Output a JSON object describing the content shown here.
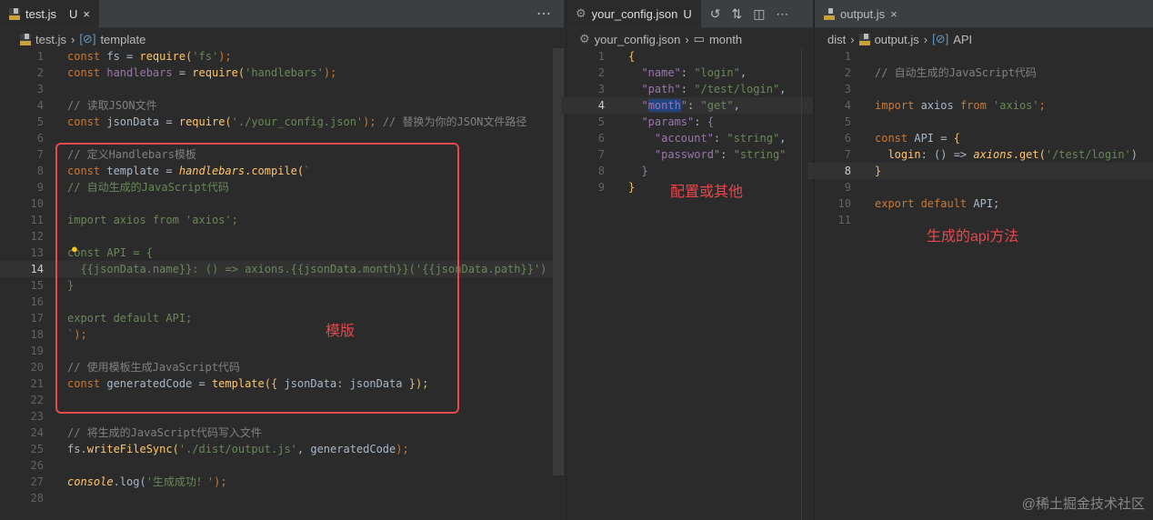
{
  "left": {
    "tab": "test.js",
    "tab_status": "U",
    "crumb_file": "test.js",
    "crumb_symbol": "template",
    "more": "⋯",
    "lines": [
      [
        [
          "const ",
          "kw"
        ],
        [
          "fs = ",
          "pl"
        ],
        [
          "require",
          "fn"
        ],
        [
          "(",
          "br"
        ],
        [
          "'fs'",
          "str"
        ],
        [
          ");",
          "kw"
        ]
      ],
      [
        [
          "const ",
          "kw"
        ],
        [
          "handlebars",
          "var"
        ],
        [
          " = ",
          "pl"
        ],
        [
          "require",
          "fn"
        ],
        [
          "(",
          "br"
        ],
        [
          "'handlebars'",
          "str"
        ],
        [
          ");",
          "kw"
        ]
      ],
      [],
      [
        [
          "// 读取JSON文件",
          "cm"
        ]
      ],
      [
        [
          "const ",
          "kw"
        ],
        [
          "jsonData = ",
          "pl"
        ],
        [
          "require",
          "fn"
        ],
        [
          "(",
          "br"
        ],
        [
          "'./your_config.json'",
          "str"
        ],
        [
          ");",
          "kw"
        ],
        [
          " // 替换为你的JSON文件路径",
          "cm"
        ]
      ],
      [],
      [
        [
          "// 定义Handlebars模板",
          "cm"
        ]
      ],
      [
        [
          "const ",
          "kw"
        ],
        [
          "template = ",
          "pl"
        ],
        [
          "handlebars",
          "it"
        ],
        [
          ".compile(",
          "fn"
        ],
        [
          "`",
          "str"
        ]
      ],
      [
        [
          "// 自动生成的JavaScript代码",
          "str"
        ]
      ],
      [],
      [
        [
          "import axios from 'axios';",
          "str"
        ]
      ],
      [],
      [
        [
          "const API = {",
          "str"
        ]
      ],
      [
        [
          "  {{jsonData.name}}: () => axions.{{jsonData.month}}('{{jsonData.path}}')",
          "str"
        ]
      ],
      [
        [
          "}",
          "str"
        ]
      ],
      [],
      [
        [
          "export default API;",
          "str"
        ]
      ],
      [
        [
          "`",
          "str"
        ],
        [
          ");",
          "kw"
        ]
      ],
      [],
      [
        [
          "// 使用模板生成JavaScript代码",
          "cm"
        ]
      ],
      [
        [
          "const ",
          "kw"
        ],
        [
          "generatedCode = ",
          "pl"
        ],
        [
          "template",
          "fn"
        ],
        [
          "({ ",
          "br"
        ],
        [
          "jsonData: jsonData ",
          "pl"
        ],
        [
          "});",
          "br"
        ]
      ],
      [],
      [],
      [
        [
          "// 将生成的JavaScript代码写入文件",
          "cm"
        ]
      ],
      [
        [
          "fs.",
          "pl"
        ],
        [
          "writeFileSync",
          "fn"
        ],
        [
          "(",
          "br"
        ],
        [
          "'./dist/output.js'",
          "str"
        ],
        [
          ", generatedCode",
          "pl"
        ],
        [
          ");",
          "kw"
        ]
      ],
      [],
      [
        [
          "console",
          "it"
        ],
        [
          ".log(",
          "pl"
        ],
        [
          "'生成成功！'",
          "str"
        ],
        [
          ");",
          "kw"
        ]
      ],
      []
    ],
    "current_line": 14,
    "note": "模版"
  },
  "middle": {
    "tab": "your_config.json",
    "tab_status": "U",
    "crumb_file": "your_config.json",
    "crumb_symbol": "month",
    "lines": [
      [
        [
          "{",
          "br"
        ]
      ],
      [
        [
          "  \"name\"",
          "key"
        ],
        [
          ": ",
          "pl"
        ],
        [
          "\"login\"",
          "str"
        ],
        [
          ",",
          "pl"
        ]
      ],
      [
        [
          "  \"path\"",
          "key"
        ],
        [
          ": ",
          "pl"
        ],
        [
          "\"/test/login\"",
          "str"
        ],
        [
          ",",
          "pl"
        ]
      ],
      [
        [
          "  \"",
          "key"
        ],
        [
          "month",
          "sel"
        ],
        [
          "\"",
          "key"
        ],
        [
          ": ",
          "pl"
        ],
        [
          "\"get\"",
          "str"
        ],
        [
          ",",
          "pl"
        ]
      ],
      [
        [
          "  \"params\"",
          "key"
        ],
        [
          ": ",
          "pl"
        ],
        [
          "{",
          "var"
        ]
      ],
      [
        [
          "    \"account\"",
          "key"
        ],
        [
          ": ",
          "pl"
        ],
        [
          "\"string\"",
          "str"
        ],
        [
          ",",
          "pl"
        ]
      ],
      [
        [
          "    \"password\"",
          "key"
        ],
        [
          ": ",
          "pl"
        ],
        [
          "\"string\"",
          "str"
        ]
      ],
      [
        [
          "  }",
          "var"
        ]
      ],
      [
        [
          "}",
          "br"
        ]
      ]
    ],
    "current_line": 4,
    "note": "配置或其他"
  },
  "right": {
    "tab": "output.js",
    "crumb_dir": "dist",
    "crumb_file": "output.js",
    "crumb_symbol": "API",
    "lines": [
      [],
      [
        [
          "// 自动生成的JavaScript代码",
          "cm"
        ]
      ],
      [],
      [
        [
          "import ",
          "kw"
        ],
        [
          "axios ",
          "pl"
        ],
        [
          "from ",
          "kw"
        ],
        [
          "'axios'",
          "str"
        ],
        [
          ";",
          "kw"
        ]
      ],
      [],
      [
        [
          "const ",
          "kw"
        ],
        [
          "API = ",
          "pl"
        ],
        [
          "{",
          "br"
        ]
      ],
      [
        [
          "  login",
          "fn"
        ],
        [
          ": () => ",
          "pl"
        ],
        [
          "axions",
          "it"
        ],
        [
          ".get(",
          "fn"
        ],
        [
          "'/test/login'",
          "str"
        ],
        [
          ")",
          "pl"
        ]
      ],
      [
        [
          "}",
          "br"
        ]
      ],
      [],
      [
        [
          "export default ",
          "kw"
        ],
        [
          "API;",
          "pl"
        ]
      ],
      []
    ],
    "current_line": 8,
    "note": "生成的api方法"
  },
  "watermark": "@稀土掘金技术社区"
}
